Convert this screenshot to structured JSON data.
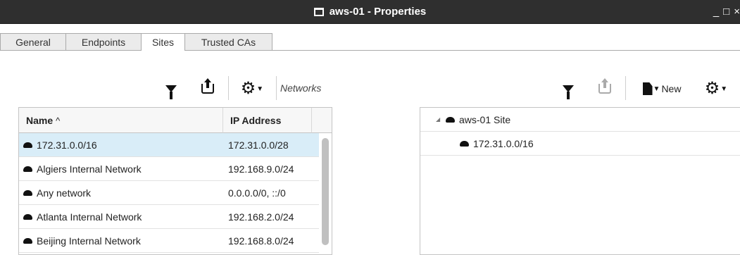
{
  "window": {
    "title": "aws-01 - Properties",
    "controls": [
      "_",
      "□",
      "×"
    ]
  },
  "tabs": [
    {
      "label": "General",
      "active": false
    },
    {
      "label": "Endpoints",
      "active": false
    },
    {
      "label": "Sites",
      "active": true
    },
    {
      "label": "Trusted CAs",
      "active": false
    }
  ],
  "left_toolbar": {
    "networks_label": "Networks",
    "icons": [
      "filter-icon",
      "export-icon",
      "gear-icon"
    ]
  },
  "left_table": {
    "columns": [
      "Name",
      "IP Address"
    ],
    "sort_indicator": "^",
    "rows": [
      {
        "name": "172.31.0.0/16",
        "ip": "172.31.0.0/28",
        "selected": true
      },
      {
        "name": "Algiers Internal Network",
        "ip": "192.168.9.0/24",
        "selected": false
      },
      {
        "name": "Any network",
        "ip": "0.0.0.0/0, ::/0",
        "selected": false
      },
      {
        "name": "Atlanta Internal Network",
        "ip": "192.168.2.0/24",
        "selected": false
      },
      {
        "name": "Beijing Internal Network",
        "ip": "192.168.8.0/24",
        "selected": false
      }
    ]
  },
  "right_toolbar": {
    "new_label": "New",
    "icons": [
      "filter-icon",
      "export-icon",
      "new-document-icon",
      "gear-icon"
    ]
  },
  "tree": {
    "root": {
      "label": "aws-01 Site",
      "expander": "◢"
    },
    "children": [
      {
        "label": "172.31.0.0/16"
      }
    ]
  },
  "colors": {
    "titlebar": "#2f2f2f",
    "selected_row": "#d9edf8"
  }
}
